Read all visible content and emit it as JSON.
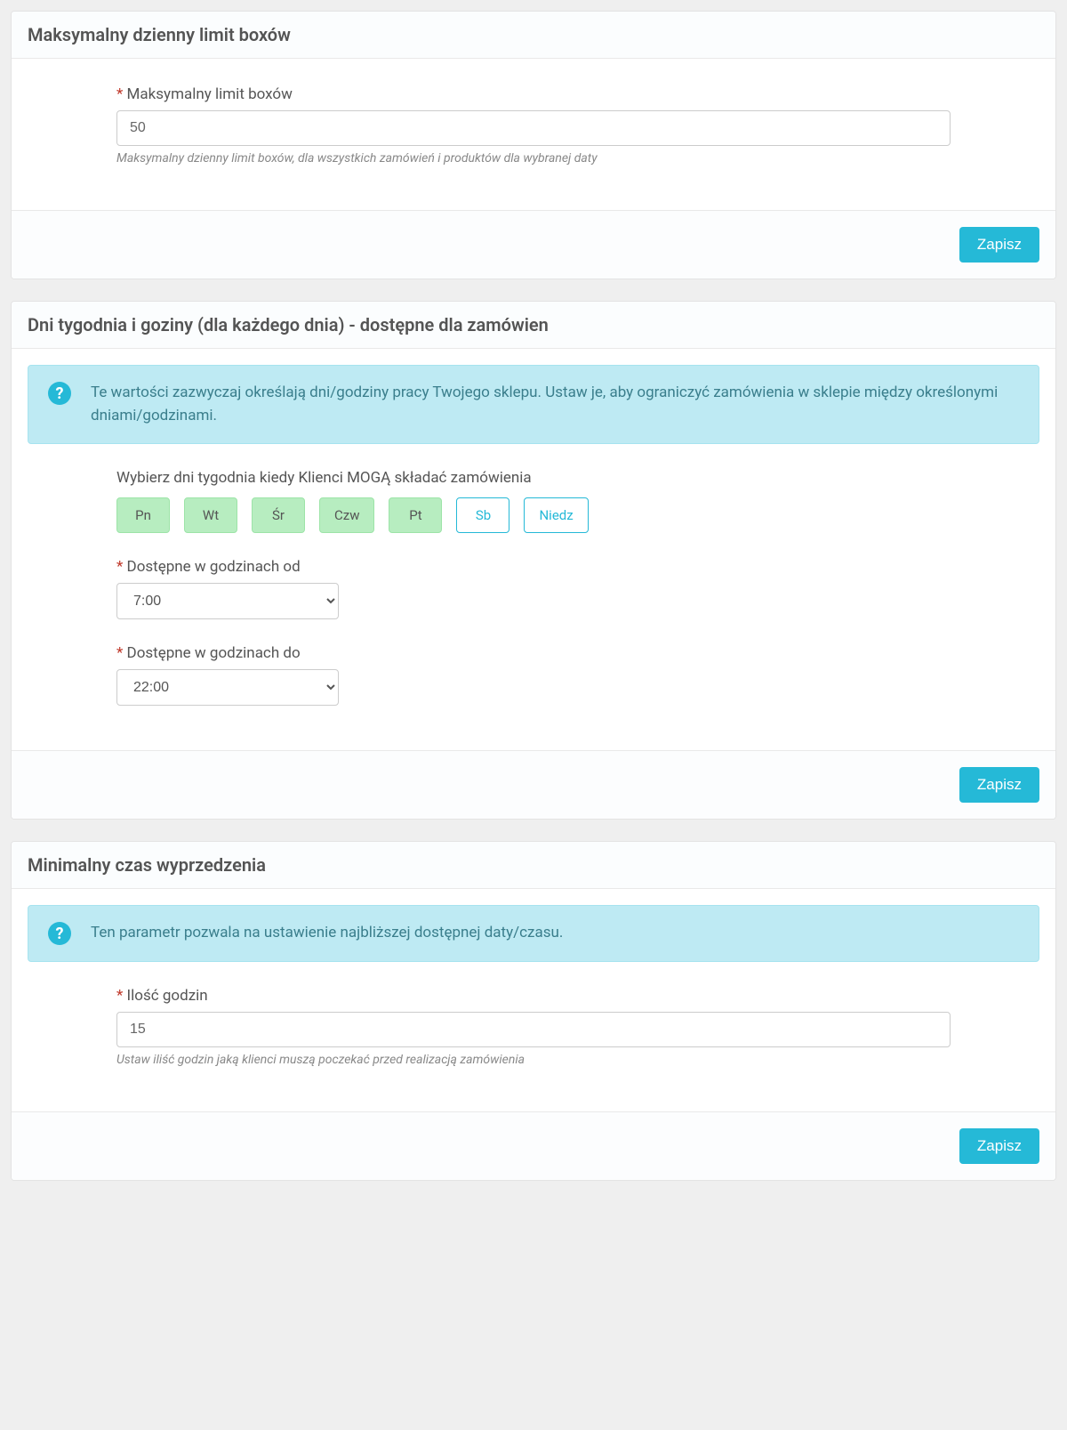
{
  "panel1": {
    "title": "Maksymalny dzienny limit boxów",
    "field_label": "Maksymalny limit boxów",
    "field_value": "50",
    "help": "Maksymalny dzienny limit boxów, dla wszystkich zamówień i produktów dla wybranej daty",
    "save": "Zapisz"
  },
  "panel2": {
    "title": "Dni tygodnia i goziny (dla każdego dnia) - dostępne dla zamówien",
    "info": "Te wartości zazwyczaj określają dni/godziny pracy Twojego sklepu. Ustaw je, aby ograniczyć zamówienia w sklepie między określonymi dniami/godzinami.",
    "days_label": "Wybierz dni tygodnia kiedy Klienci MOGĄ składać zamówienia",
    "days": [
      {
        "label": "Pn",
        "selected": true
      },
      {
        "label": "Wt",
        "selected": true
      },
      {
        "label": "Śr",
        "selected": true
      },
      {
        "label": "Czw",
        "selected": true
      },
      {
        "label": "Pt",
        "selected": true
      },
      {
        "label": "Sb",
        "selected": false
      },
      {
        "label": "Niedz",
        "selected": false
      }
    ],
    "from_label": "Dostępne w godzinach od",
    "from_value": "7:00",
    "to_label": "Dostępne w godzinach do",
    "to_value": "22:00",
    "save": "Zapisz"
  },
  "panel3": {
    "title": "Minimalny czas wyprzedzenia",
    "info": "Ten parametr pozwala na ustawienie najbliższej dostępnej daty/czasu.",
    "field_label": "Ilość godzin",
    "field_value": "15",
    "help": "Ustaw iliść godzin jaką klienci muszą poczekać przed realizacją zamówienia",
    "save": "Zapisz"
  }
}
